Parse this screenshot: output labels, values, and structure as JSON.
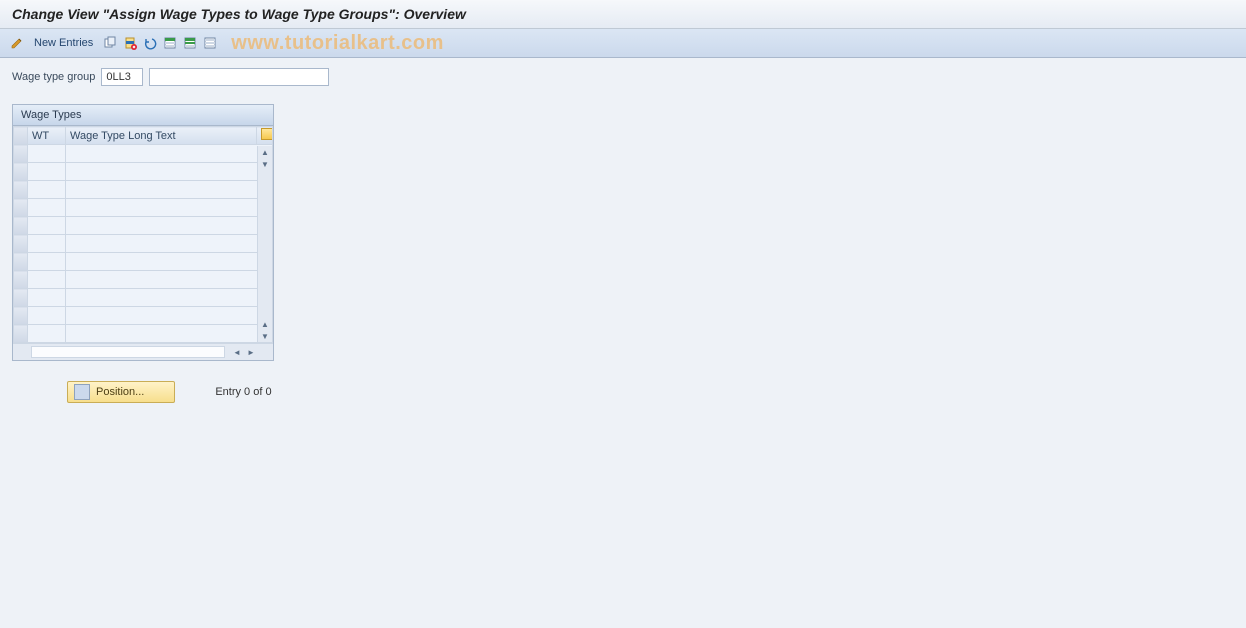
{
  "title": "Change View \"Assign Wage Types to Wage Type Groups\": Overview",
  "toolbar": {
    "new_entries_label": "New Entries"
  },
  "watermark": "www.tutorialkart.com",
  "fields": {
    "wage_type_group_label": "Wage type group",
    "wage_type_group_value": "0LL3",
    "wage_type_group_desc": ""
  },
  "panel": {
    "title": "Wage Types",
    "columns": {
      "wt": "WT",
      "long_text": "Wage Type Long Text"
    },
    "rows": [
      {
        "wt": "",
        "long_text": ""
      },
      {
        "wt": "",
        "long_text": ""
      },
      {
        "wt": "",
        "long_text": ""
      },
      {
        "wt": "",
        "long_text": ""
      },
      {
        "wt": "",
        "long_text": ""
      },
      {
        "wt": "",
        "long_text": ""
      },
      {
        "wt": "",
        "long_text": ""
      },
      {
        "wt": "",
        "long_text": ""
      },
      {
        "wt": "",
        "long_text": ""
      },
      {
        "wt": "",
        "long_text": ""
      },
      {
        "wt": "",
        "long_text": ""
      }
    ]
  },
  "footer": {
    "position_label": "Position...",
    "entry_label": "Entry 0 of 0"
  }
}
